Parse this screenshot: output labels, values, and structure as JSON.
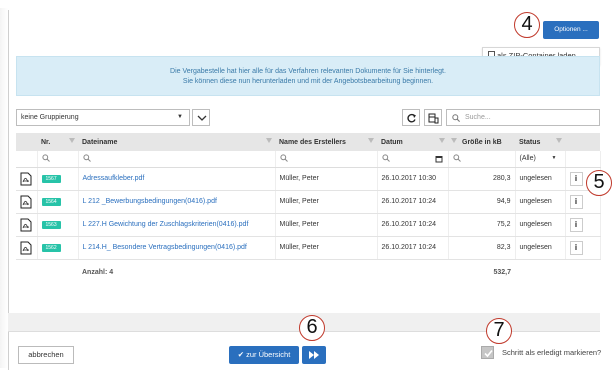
{
  "toolbar": {
    "options_label": "Optionen ...",
    "zip_label": "als ZIP-Container laden",
    "grouping_value": "keine Gruppierung",
    "search_placeholder": "Suche..."
  },
  "info": {
    "line1": "Die Vergabestelle hat hier alle für das Verfahren relevanten Dokumente für Sie hinterlegt.",
    "line2": "Sie können diese nun herunterladen und mit der Angebotsbearbeitung beginnen."
  },
  "table": {
    "headers": [
      "Nr.",
      "Dateiname",
      "Name des Erstellers",
      "Datum",
      "Größe in kB",
      "Status"
    ],
    "status_filter": "(Alle)",
    "rows": [
      {
        "nr": "1567",
        "filename": "Adressaufkleber.pdf",
        "creator": "Müller, Peter",
        "date": "26.10.2017 10:30",
        "size": "280,3",
        "status": "ungelesen"
      },
      {
        "nr": "1564",
        "filename": "L 212 _Bewerbungsbedingungen(0416).pdf",
        "creator": "Müller, Peter",
        "date": "26.10.2017 10:24",
        "size": "94,9",
        "status": "ungelesen"
      },
      {
        "nr": "1563",
        "filename": "L 227.H Gewichtung der Zuschlagskriterien(0416).pdf",
        "creator": "Müller, Peter",
        "date": "26.10.2017 10:24",
        "size": "75,2",
        "status": "ungelesen"
      },
      {
        "nr": "1562",
        "filename": "L 214.H_ Besondere Vertragsbedingungen(0416).pdf",
        "creator": "Müller, Peter",
        "date": "26.10.2017 10:24",
        "size": "82,3",
        "status": "ungelesen"
      }
    ],
    "count_label": "Anzahl: 4",
    "size_total": "532,7",
    "info_glyph": "i"
  },
  "footer": {
    "cancel_label": "abbrechen",
    "overview_label": "zur Übersicht",
    "done_label": "Schritt als erledigt markieren?"
  },
  "callouts": {
    "c4": "4",
    "c5": "5",
    "c6": "6",
    "c7": "7"
  },
  "colors": {
    "accent": "#2a6fbe",
    "badge": "#27c3a8",
    "info_bg": "#d9edf7",
    "callout_border": "#c0392b"
  }
}
